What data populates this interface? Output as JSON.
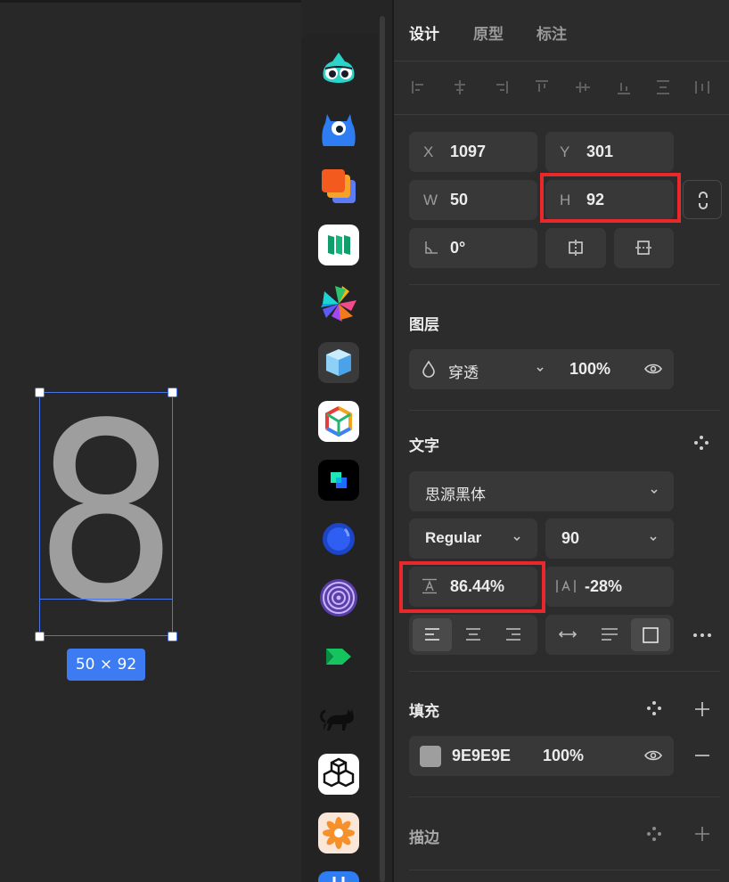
{
  "tabs": [
    "设计",
    "原型",
    "标注"
  ],
  "position": {
    "x_label": "X",
    "x_value": "1097",
    "y_label": "Y",
    "y_value": "301"
  },
  "size": {
    "w_label": "W",
    "w_value": "50",
    "h_label": "H",
    "h_value": "92"
  },
  "rotation": {
    "value": "0°"
  },
  "layer": {
    "title": "图层",
    "blend_mode": "穿透",
    "opacity": "100%"
  },
  "text": {
    "title": "文字",
    "font_family": "思源黑体",
    "font_weight": "Regular",
    "font_size": "90",
    "line_height": "86.44%",
    "letter_spacing": "-28%"
  },
  "fill": {
    "title": "填充",
    "hex": "9E9E9E",
    "opacity": "100%",
    "swatch": "#9e9e9e"
  },
  "stroke": {
    "title": "描边"
  },
  "canvas": {
    "glyph": "8",
    "dimension_badge": "50 × 92"
  },
  "colors": {
    "accent": "#3d7bf2",
    "highlight": "#e8282b",
    "panel_bg": "#2c2c2c"
  },
  "dock_apps": [
    "frog-app",
    "blue-monster-app",
    "stacked-squares-app",
    "green-bars-app",
    "pinwheel-app",
    "ice-cube-app",
    "hexagon-cube-app",
    "teal-square-app",
    "blue-orb-app",
    "purple-rings-app",
    "green-arrow-app",
    "black-cat-app",
    "cubes-app",
    "orange-flower-app",
    "blue-grid-app"
  ]
}
